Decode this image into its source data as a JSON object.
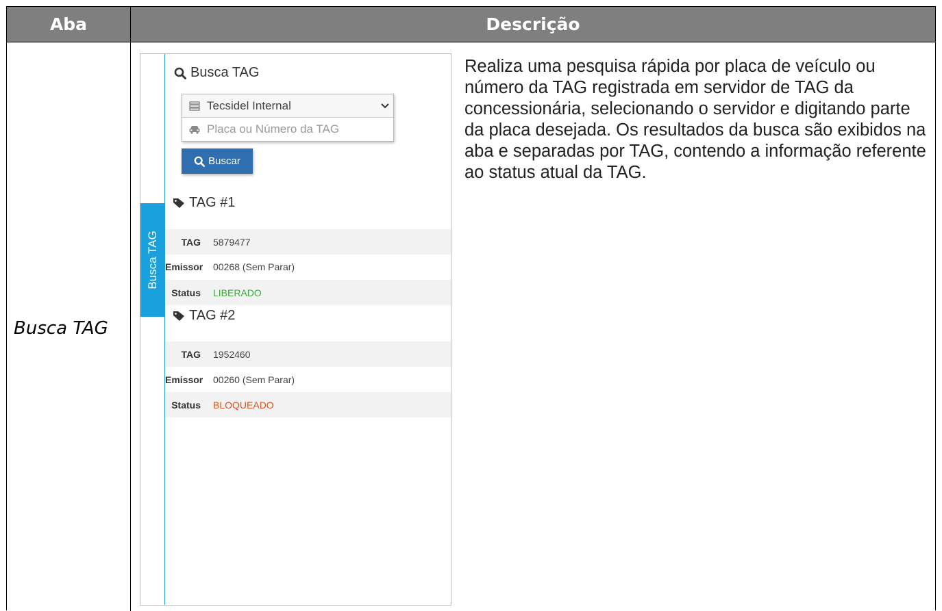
{
  "table": {
    "header_aba": "Aba",
    "header_descricao": "Descrição",
    "aba_name": "Busca TAG",
    "description": "Realiza uma pesquisa rápida por placa de veículo ou número da TAG registrada em servidor de TAG da concessionária, selecionando o servidor e digitando parte da placa desejada. Os resultados da busca são exibidos na aba e separadas por TAG, contendo a informação referente ao status atual da TAG."
  },
  "panel": {
    "side_tab_label": "Busca TAG",
    "title": "Busca TAG",
    "server_select": {
      "value": "Tecsidel Internal"
    },
    "search_input": {
      "placeholder": "Placa ou Número da TAG",
      "value": ""
    },
    "search_button": "Buscar",
    "results": [
      {
        "heading": "TAG #1",
        "tag_label": "TAG",
        "tag_value": "5879477",
        "emissor_label": "Emissor",
        "emissor_value": "00268 (Sem Parar)",
        "status_label": "Status",
        "status_value": "LIBERADO"
      },
      {
        "heading": "TAG #2",
        "tag_label": "TAG",
        "tag_value": "1952460",
        "emissor_label": "Emissor",
        "emissor_value": "00260 (Sem Parar)",
        "status_label": "Status",
        "status_value": "BLOQUEADO"
      }
    ]
  },
  "colors": {
    "header_bg": "#7f7f7f",
    "accent_blue": "#1aa0dc",
    "button_blue": "#2f6fb0",
    "status_liberado": "#3aa83a",
    "status_bloqueado": "#d9531e"
  },
  "icons": {
    "title": "search-icon",
    "select": "server-icon",
    "input": "car-icon",
    "button": "search-icon",
    "result_heading": "tag-icon"
  }
}
